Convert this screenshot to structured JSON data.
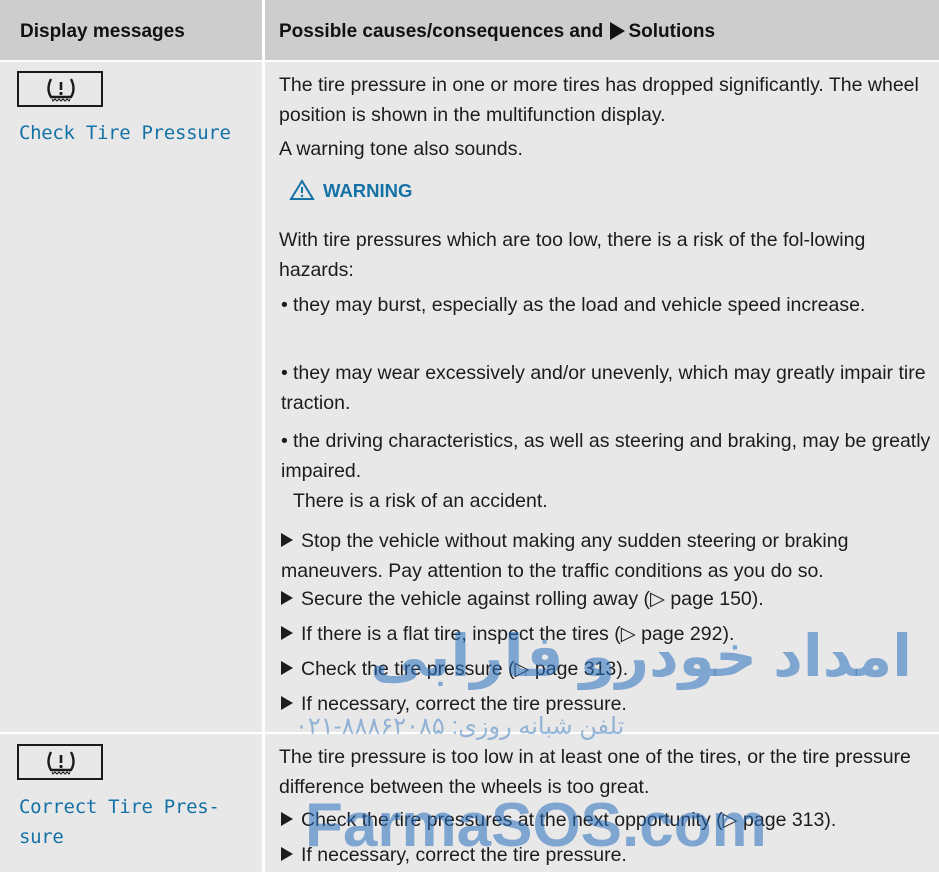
{
  "header": {
    "col1": "Display messages",
    "col2_prefix": "Possible causes/consequences and",
    "col2_suffix": "Solutions"
  },
  "rows": [
    {
      "icon": "tire-pressure-warning-icon",
      "message": "Check Tire Pressure",
      "p1": "The tire pressure in one or more tires has dropped significantly. The wheel position is shown in the multifunction display.",
      "p2": "A warning tone also sounds.",
      "warning_label": "WARNING",
      "warning_intro": "With tire pressures which are too low, there is a risk of the fol-lowing hazards:",
      "hazards": [
        "they may burst, especially as the load and vehicle speed increase.",
        "they may wear excessively and/or unevenly, which may greatly impair tire traction.",
        "the driving characteristics, as well as steering and braking, may be greatly impaired."
      ],
      "risk": "There is a risk of an accident.",
      "steps": [
        "Stop the vehicle without making any sudden steering or braking maneuvers. Pay attention to the traffic conditions as you do so.",
        "Secure the vehicle against rolling away (▷ page 150).",
        "If there is a flat tire, inspect the tires (▷ page 292).",
        "Check the tire pressure (▷ page 313).",
        "If necessary, correct the tire pressure."
      ]
    },
    {
      "icon": "tire-pressure-warning-icon",
      "message": "Correct Tire Pres-sure",
      "p1": "The tire pressure is too low in at least one of the tires, or the tire pressure difference between the wheels is too great.",
      "steps": [
        "Check the tire pressures at the next opportunity (▷ page 313).",
        "If necessary, correct the tire pressure."
      ]
    }
  ],
  "watermark": {
    "persian": "امداد خودرو فارابی",
    "phone": "۰۲۱-۸۸۸۶۲۰۸۵ :تلفن شبانه روزی",
    "site": "FarmaSOS.com"
  },
  "colors": {
    "accent": "#1572a6",
    "header_bg": "#cdcdcd",
    "cell_bg": "#e8e8e8"
  }
}
